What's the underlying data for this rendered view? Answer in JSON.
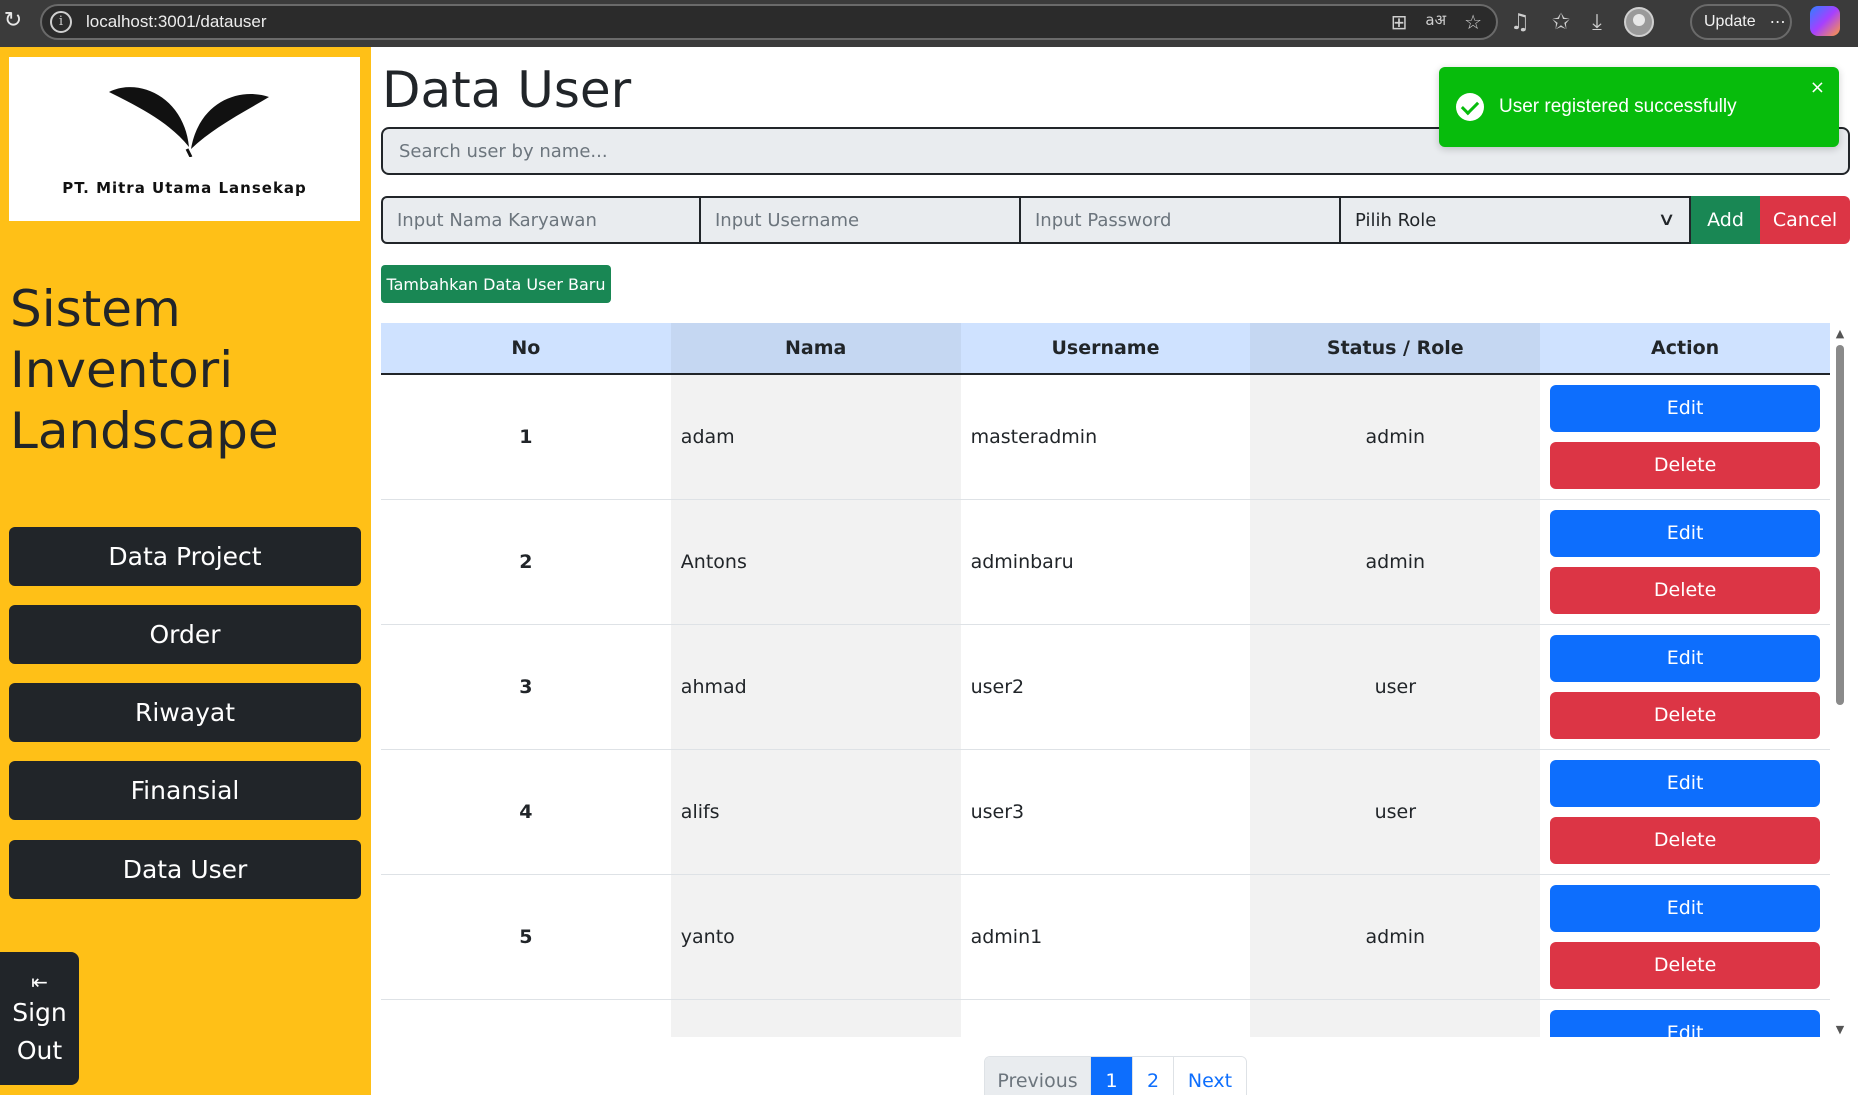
{
  "browser": {
    "url": "localhost:3001/datauser",
    "update_label": "Update",
    "more_label": "⋯"
  },
  "sidebar": {
    "logo_text": "PT. Mitra Utama Lansekap",
    "app_title": "Sistem Inventori Landscape",
    "nav_items": [
      {
        "label": "Data Project"
      },
      {
        "label": "Order"
      },
      {
        "label": "Riwayat"
      },
      {
        "label": "Finansial"
      },
      {
        "label": "Data User"
      }
    ],
    "signout": {
      "icon": "logout-icon",
      "line1": "Sign",
      "line2": "Out"
    }
  },
  "main": {
    "title": "Data User",
    "search_placeholder": "Search user by name...",
    "form": {
      "nama_placeholder": "Input Nama Karyawan",
      "username_placeholder": "Input Username",
      "password_placeholder": "Input Password",
      "role_selected": "Pilih Role",
      "add_label": "Add",
      "cancel_label": "Cancel"
    },
    "new_button_label": "Tambahkan Data User Baru",
    "table": {
      "headers": [
        "No",
        "Nama",
        "Username",
        "Status / Role",
        "Action"
      ],
      "rows": [
        {
          "no": "1",
          "nama": "adam",
          "username": "masteradmin",
          "role": "admin"
        },
        {
          "no": "2",
          "nama": "Antons",
          "username": "adminbaru",
          "role": "admin"
        },
        {
          "no": "3",
          "nama": "ahmad",
          "username": "user2",
          "role": "user"
        },
        {
          "no": "4",
          "nama": "alifs",
          "username": "user3",
          "role": "user"
        },
        {
          "no": "5",
          "nama": "yanto",
          "username": "admin1",
          "role": "admin"
        },
        {
          "no": "",
          "nama": "",
          "username": "",
          "role": ""
        }
      ],
      "edit_label": "Edit",
      "delete_label": "Delete"
    },
    "pagination": {
      "previous": "Previous",
      "pages": [
        "1",
        "2"
      ],
      "next": "Next",
      "current_page": 1
    }
  },
  "toast": {
    "message": "User registered successfully",
    "close": "×"
  },
  "colors": {
    "sidebar_bg": "#ffc017",
    "nav_bg": "#212529",
    "primary": "#0d6efd",
    "danger": "#dc3545",
    "success": "#198754",
    "toast_bg": "#07bc0c"
  }
}
